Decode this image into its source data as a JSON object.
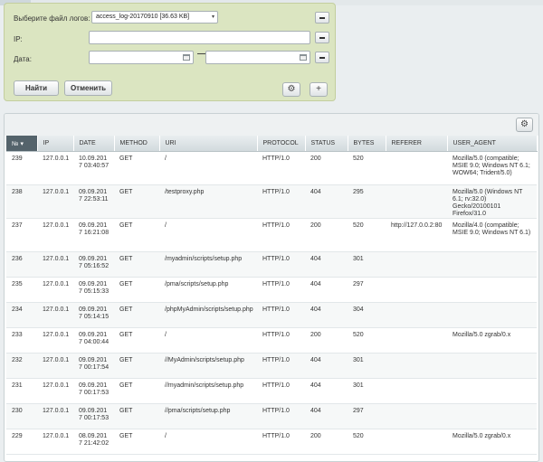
{
  "filter": {
    "file_label": "Выберите файл логов:",
    "file_value": "access_log-20170910 [36.63 KB]",
    "ip_label": "IP:",
    "date_label": "Дата:",
    "find_button": "Найти",
    "cancel_button": "Отменить"
  },
  "table": {
    "columns": [
      "№",
      "IP",
      "DATE",
      "METHOD",
      "URI",
      "PROTOCOL",
      "STATUS",
      "BYTES",
      "REFERER",
      "USER_AGENT"
    ],
    "rows": [
      {
        "num": "239",
        "ip": "127.0.0.1",
        "date": "10.09.2017 03:40:57",
        "method": "GET",
        "uri": "/",
        "protocol": "HTTP/1.0",
        "status": "200",
        "bytes": "520",
        "referer": "",
        "agent": "Mozilla/5.0 (compatible; MSIE 9.0; Windows NT 6.1; WOW64; Trident/5.0)"
      },
      {
        "num": "238",
        "ip": "127.0.0.1",
        "date": "09.09.2017 22:53:11",
        "method": "GET",
        "uri": "/testproxy.php",
        "protocol": "HTTP/1.0",
        "status": "404",
        "bytes": "295",
        "referer": "",
        "agent": "Mozilla/5.0 (Windows NT 6.1; rv:32.0) Gecko/20100101 Firefox/31.0"
      },
      {
        "num": "237",
        "ip": "127.0.0.1",
        "date": "09.09.2017 16:21:08",
        "method": "GET",
        "uri": "/",
        "protocol": "HTTP/1.0",
        "status": "200",
        "bytes": "520",
        "referer": "http://127.0.0.2:80",
        "agent": "Mozilla/4.0 (compatible; MSIE 9.0; Windows NT 6.1)"
      },
      {
        "num": "236",
        "ip": "127.0.0.1",
        "date": "09.09.2017 05:16:52",
        "method": "GET",
        "uri": "/myadmin/scripts/setup.php",
        "protocol": "HTTP/1.0",
        "status": "404",
        "bytes": "301",
        "referer": "",
        "agent": ""
      },
      {
        "num": "235",
        "ip": "127.0.0.1",
        "date": "09.09.2017 05:15:33",
        "method": "GET",
        "uri": "/pma/scripts/setup.php",
        "protocol": "HTTP/1.0",
        "status": "404",
        "bytes": "297",
        "referer": "",
        "agent": ""
      },
      {
        "num": "234",
        "ip": "127.0.0.1",
        "date": "09.09.2017 05:14:15",
        "method": "GET",
        "uri": "/phpMyAdmin/scripts/setup.php",
        "protocol": "HTTP/1.0",
        "status": "404",
        "bytes": "304",
        "referer": "",
        "agent": ""
      },
      {
        "num": "233",
        "ip": "127.0.0.1",
        "date": "09.09.2017 04:00:44",
        "method": "GET",
        "uri": "/",
        "protocol": "HTTP/1.0",
        "status": "200",
        "bytes": "520",
        "referer": "",
        "agent": "Mozilla/5.0 zgrab/0.x"
      },
      {
        "num": "232",
        "ip": "127.0.0.1",
        "date": "09.09.2017 00:17:54",
        "method": "GET",
        "uri": "//MyAdmin/scripts/setup.php",
        "protocol": "HTTP/1.0",
        "status": "404",
        "bytes": "301",
        "referer": "",
        "agent": ""
      },
      {
        "num": "231",
        "ip": "127.0.0.1",
        "date": "09.09.2017 00:17:53",
        "method": "GET",
        "uri": "//myadmin/scripts/setup.php",
        "protocol": "HTTP/1.0",
        "status": "404",
        "bytes": "301",
        "referer": "",
        "agent": ""
      },
      {
        "num": "230",
        "ip": "127.0.0.1",
        "date": "09.09.2017 00:17:53",
        "method": "GET",
        "uri": "//pma/scripts/setup.php",
        "protocol": "HTTP/1.0",
        "status": "404",
        "bytes": "297",
        "referer": "",
        "agent": ""
      },
      {
        "num": "229",
        "ip": "127.0.0.1",
        "date": "08.09.2017 21:42:02",
        "method": "GET",
        "uri": "/",
        "protocol": "HTTP/1.0",
        "status": "200",
        "bytes": "520",
        "referer": "",
        "agent": "Mozilla/5.0 zgrab/0.x"
      }
    ]
  }
}
